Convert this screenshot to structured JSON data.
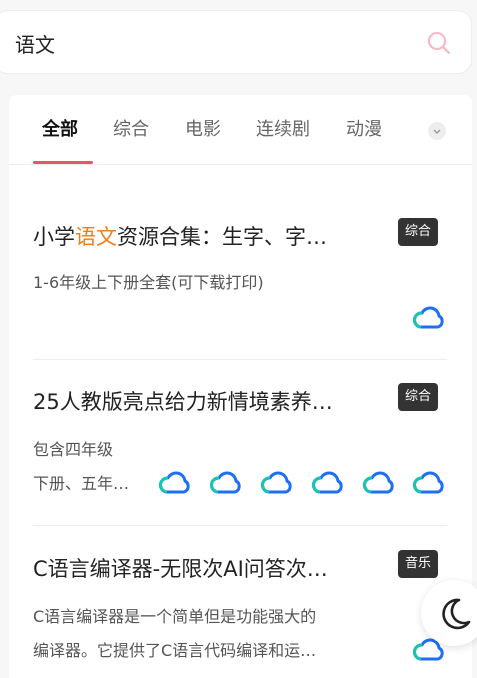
{
  "search": {
    "value": "语文"
  },
  "tabs": [
    {
      "label": "全部"
    },
    {
      "label": "综合"
    },
    {
      "label": "电影"
    },
    {
      "label": "连续剧"
    },
    {
      "label": "动漫"
    }
  ],
  "results": [
    {
      "title_prefix": "小学",
      "title_highlight": "语文",
      "title_rest": "资源合集：生字、字…",
      "badge": "综合",
      "desc_lines": [
        "1-6年级上下册全套(可下载打印)"
      ]
    },
    {
      "title_prefix": "25人教版亮点给力新情境素养…",
      "title_highlight": "",
      "title_rest": "",
      "badge": "综合",
      "desc_lines": [
        "包含四年级",
        "下册、五年…"
      ]
    },
    {
      "title_prefix": "C语言编译器-无限次AI问答次…",
      "title_highlight": "",
      "title_rest": "",
      "badge": "音乐",
      "desc_lines": [
        "C语言编译器是一个简单但是功能强大的",
        "编译器。它提供了C语言代码编译和运…"
      ]
    }
  ],
  "colors": {
    "accent": "#e8556a",
    "highlight": "#f07d1a",
    "cloud_primary": "#1e6ff5",
    "cloud_secondary": "#19c4b0"
  },
  "icons": {
    "search": "search-icon",
    "cloud": "cloud-drive-icon",
    "moon": "dark-mode-moon-icon",
    "expand": "chevron-down-icon"
  }
}
